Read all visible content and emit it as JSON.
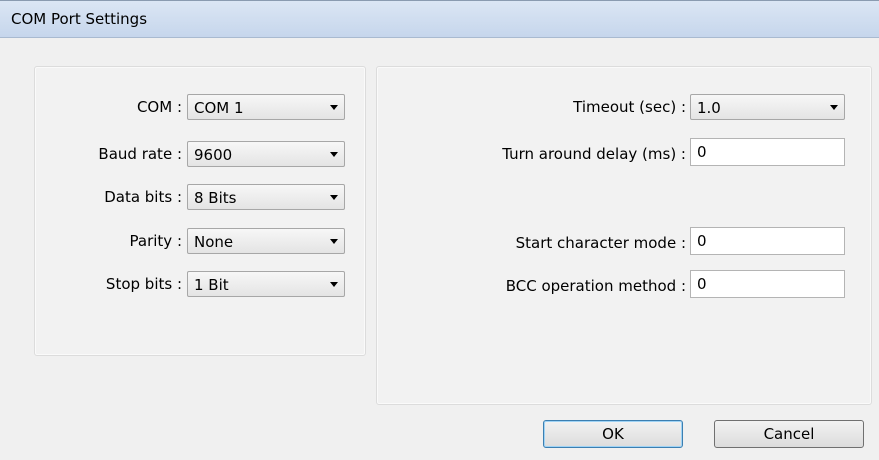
{
  "window": {
    "title": "COM Port Settings"
  },
  "left": {
    "com": {
      "label": "COM :",
      "value": "COM 1"
    },
    "baud": {
      "label": "Baud rate :",
      "value": "9600"
    },
    "data_bits": {
      "label": "Data bits :",
      "value": "8 Bits"
    },
    "parity": {
      "label": "Parity :",
      "value": "None"
    },
    "stop_bits": {
      "label": "Stop bits :",
      "value": "1 Bit"
    }
  },
  "right": {
    "timeout": {
      "label": "Timeout (sec) :",
      "value": "1.0"
    },
    "turnaround": {
      "label": "Turn around delay (ms) :",
      "value": "0"
    },
    "start_char": {
      "label": "Start character mode :",
      "value": "0"
    },
    "bcc": {
      "label": "BCC operation method :",
      "value": "0"
    }
  },
  "buttons": {
    "ok": "OK",
    "cancel": "Cancel"
  }
}
